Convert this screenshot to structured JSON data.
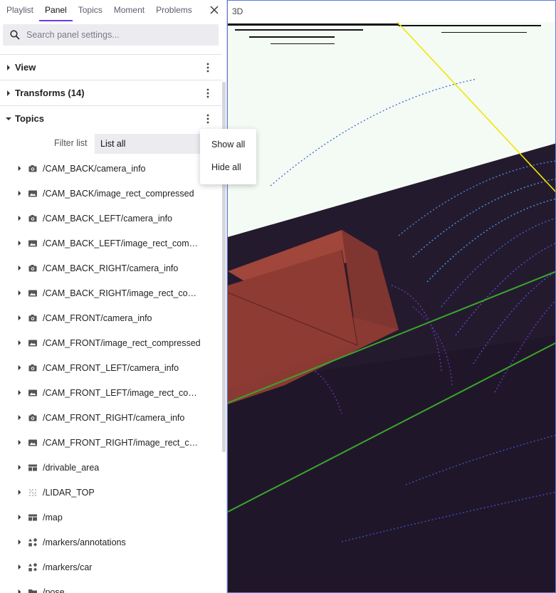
{
  "tabs": [
    "Playlist",
    "Panel",
    "Topics",
    "Moment",
    "Problems"
  ],
  "active_tab": "Panel",
  "search": {
    "placeholder": "Search panel settings..."
  },
  "sections": {
    "view": "View",
    "transforms": "Transforms (14)",
    "topics": "Topics"
  },
  "filter": {
    "label": "Filter list",
    "value": "List all"
  },
  "menu": {
    "show_all": "Show all",
    "hide_all": "Hide all"
  },
  "topics": [
    {
      "name": "/CAM_BACK/camera_info",
      "icon": "camera-icon"
    },
    {
      "name": "/CAM_BACK/image_rect_compressed",
      "icon": "image-icon"
    },
    {
      "name": "/CAM_BACK_LEFT/camera_info",
      "icon": "camera-icon"
    },
    {
      "name": "/CAM_BACK_LEFT/image_rect_compr...",
      "icon": "image-icon"
    },
    {
      "name": "/CAM_BACK_RIGHT/camera_info",
      "icon": "camera-icon"
    },
    {
      "name": "/CAM_BACK_RIGHT/image_rect_com...",
      "icon": "image-icon"
    },
    {
      "name": "/CAM_FRONT/camera_info",
      "icon": "camera-icon"
    },
    {
      "name": "/CAM_FRONT/image_rect_compressed",
      "icon": "image-icon"
    },
    {
      "name": "/CAM_FRONT_LEFT/camera_info",
      "icon": "camera-icon"
    },
    {
      "name": "/CAM_FRONT_LEFT/image_rect_com...",
      "icon": "image-icon"
    },
    {
      "name": "/CAM_FRONT_RIGHT/camera_info",
      "icon": "camera-icon"
    },
    {
      "name": "/CAM_FRONT_RIGHT/image_rect_co...",
      "icon": "image-icon"
    },
    {
      "name": "/drivable_area",
      "icon": "grid-icon"
    },
    {
      "name": "/LIDAR_TOP",
      "icon": "pointcloud-icon"
    },
    {
      "name": "/map",
      "icon": "grid-icon"
    },
    {
      "name": "/markers/annotations",
      "icon": "shapes-icon"
    },
    {
      "name": "/markers/car",
      "icon": "shapes-icon"
    },
    {
      "name": "/pose",
      "icon": "folder-icon"
    }
  ],
  "viewport": {
    "title": "3D"
  },
  "colors": {
    "accent": "#6f3be8",
    "viewport_border": "#5a7be0",
    "ground": "#241a2e",
    "box": "#8e3b33",
    "lane": "#3aa62c",
    "axis": "#f2e600"
  }
}
